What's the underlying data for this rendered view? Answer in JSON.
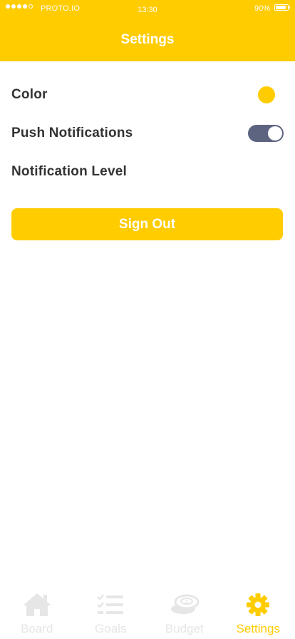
{
  "status_bar": {
    "carrier": "PROTO.IO",
    "time": "13:30",
    "battery": "90%",
    "battery_level": 0.9
  },
  "header": {
    "title": "Settings"
  },
  "settings": {
    "color_label": "Color",
    "color_value": "#FFCC00",
    "push_label": "Push Notifications",
    "push_enabled": true,
    "level_label": "Notification Level",
    "sign_out_label": "Sign Out"
  },
  "tabbar": {
    "tabs": [
      {
        "label": "Board",
        "icon": "home-icon",
        "active": false
      },
      {
        "label": "Goals",
        "icon": "checklist-icon",
        "active": false
      },
      {
        "label": "Budget",
        "icon": "coins-icon",
        "active": false
      },
      {
        "label": "Settings",
        "icon": "gear-icon",
        "active": true
      }
    ]
  },
  "colors": {
    "accent": "#FFCC00",
    "text": "#333333",
    "toggle_on": "#5C6480",
    "tab_inactive": "#E6E6E6"
  }
}
